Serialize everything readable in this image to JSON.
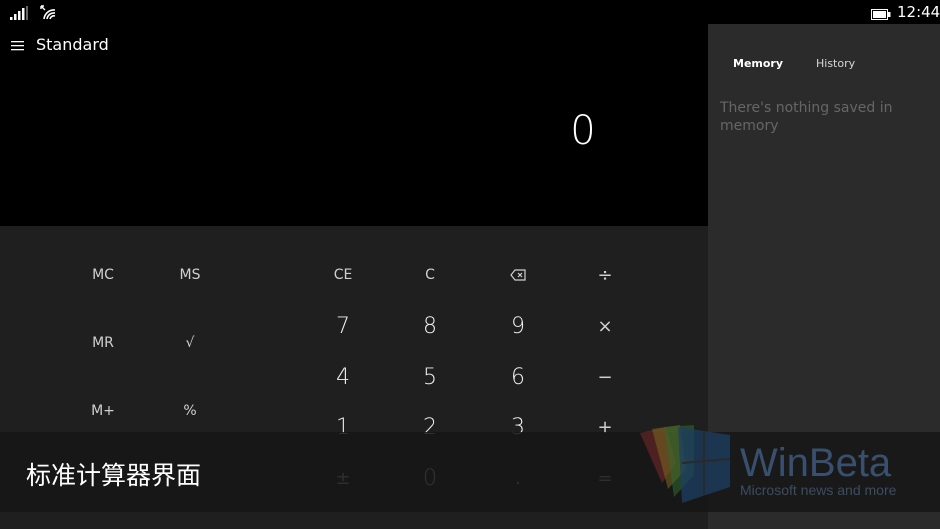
{
  "status_bar": {
    "time": "12:44"
  },
  "header": {
    "mode_title": "Standard"
  },
  "display": {
    "value": "0"
  },
  "memory_keys": [
    {
      "id": "mc",
      "label": "MC"
    },
    {
      "id": "ms",
      "label": "MS"
    },
    {
      "id": "mr",
      "label": "MR"
    },
    {
      "id": "sqrt",
      "label": "√"
    },
    {
      "id": "mplus",
      "label": "M+"
    },
    {
      "id": "percent",
      "label": "%"
    }
  ],
  "keypad": {
    "row1": [
      "CE",
      "C",
      "backspace",
      "÷"
    ],
    "row2": [
      "7",
      "8",
      "9",
      "×"
    ],
    "row3": [
      "4",
      "5",
      "6",
      "−"
    ],
    "row4": [
      "1",
      "2",
      "3",
      "+"
    ],
    "row5": [
      "±",
      "0",
      ".",
      "="
    ]
  },
  "side_panel": {
    "tabs": [
      {
        "label": "Memory",
        "active": true
      },
      {
        "label": "History",
        "active": false
      }
    ],
    "empty_message": "There's nothing saved in memory"
  },
  "caption": {
    "text": "标准计算器界面"
  },
  "watermark": {
    "brand": "WinBeta",
    "tagline": "Microsoft news and more"
  },
  "icons": {
    "menu": "hamburger-icon",
    "signal": "signal-strength-icon",
    "wifi": "wifi-icon",
    "battery": "battery-icon",
    "backspace": "backspace-icon"
  },
  "colors": {
    "background": "#000000",
    "keypad": "#1f1f1f",
    "side_panel": "#2b2b2b",
    "watermark": "#38506e"
  }
}
